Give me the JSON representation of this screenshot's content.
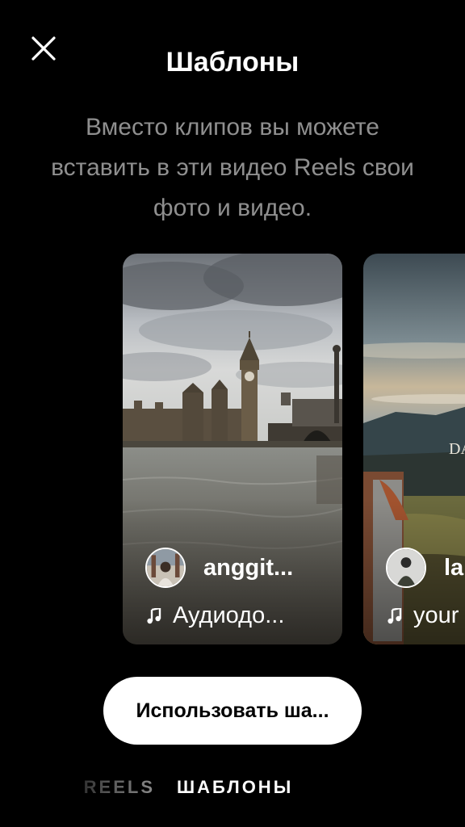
{
  "header": {
    "title": "Шаблоны",
    "close_icon": "close-icon"
  },
  "intro": {
    "text": "Вместо клипов вы можете вставить в эти видео Reels свои фото и видео."
  },
  "templates": [
    {
      "author": "anggit...",
      "audio": "Аудиодо...",
      "scene": "Big Ben and Westminster Bridge over the Thames",
      "music_icon": "music-note-icon"
    },
    {
      "author": "la",
      "audio": "your",
      "scene": "mountain landscape with person",
      "music_icon": "music-note-icon"
    }
  ],
  "actions": {
    "use_template_label": "Использовать ша..."
  },
  "tabs": {
    "reels": "REELS",
    "templates": "ШАБЛОНЫ"
  },
  "colors": {
    "background": "#000000",
    "subtitle": "#8f8f8f",
    "button_bg": "#ffffff",
    "button_text": "#000000"
  }
}
